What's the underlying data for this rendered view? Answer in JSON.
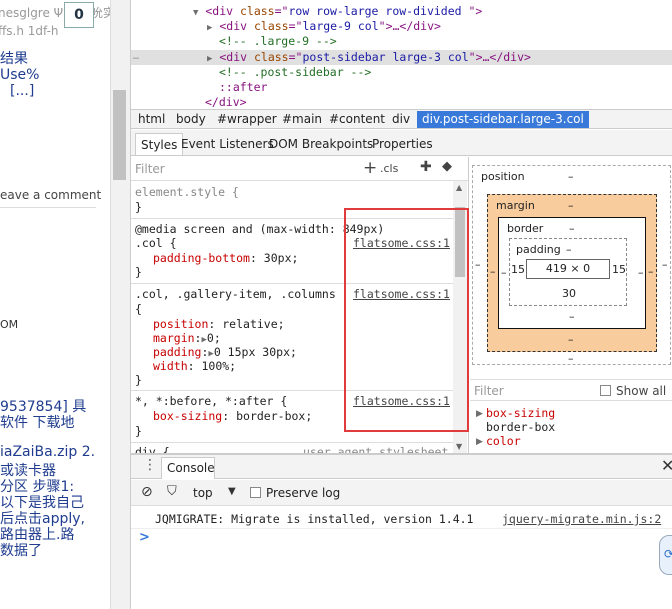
{
  "left_page": {
    "badge": "0",
    "line1": "nesglgre Ψ 要买吮实",
    "line2": "ffs.h 1df-h",
    "line3": "结果",
    "line4": "Use%",
    "line5": "[...]",
    "leave_comment": "eave a comment",
    "om": "OM",
    "line6": "9537854] 具",
    "line7": "软件 下载地",
    "line8": "iaZaiBa.zip 2.",
    "line9": "或读卡器",
    "line10": "分区 步骤1:",
    "line11": "以下是我自己",
    "line12": "后点击apply,",
    "line13": "路由器上.路",
    "line14": "数据了"
  },
  "dom_tree": {
    "line1": {
      "open": "<div ",
      "attr": "class",
      "eq": "=\"",
      "val": "row row-large row-divided ",
      "close": "\">"
    },
    "line2": {
      "open": "<div ",
      "attr": "class",
      "eq": "=\"",
      "val": "large-9 col",
      "close": "\">…</div>"
    },
    "line3": "<!-- .large-9 -->",
    "line4": {
      "open": "<div ",
      "attr": "class",
      "eq": "=\"",
      "val": "post-sidebar large-3 col",
      "close": "\">…</div>"
    },
    "line5": "<!-- .post-sidebar -->",
    "line6": "::after",
    "line7": "</div>",
    "dots": "…"
  },
  "breadcrumbs": [
    "html",
    "body",
    "#wrapper",
    "#main",
    "#content",
    "div",
    "div.post-sidebar.large-3.col"
  ],
  "subtabs": [
    "Styles",
    "Event Listeners",
    "DOM Breakpoints",
    "Properties"
  ],
  "styles": {
    "filter_placeholder": "Filter",
    "cls_label": ".cls",
    "element_style": "element.style {",
    "close_brace": "}",
    "media": "@media screen and (max-width: 849px)",
    "col_selector": ".col {",
    "pb_prop": "padding-bottom",
    "pb_val": "30px;",
    "src1": "flatsome.css:1",
    "sel2": ".col, .gallery-item, .columns",
    "open_brace": "{",
    "position_prop": "position",
    "position_val": "relative;",
    "margin_prop": "margin",
    "margin_val": "0;",
    "padding_prop": "padding",
    "padding_val": "0 15px 30px;",
    "width_prop": "width",
    "width_val": "100%;",
    "sel3": "*, *:before, *:after {",
    "bs_prop": "box-sizing",
    "bs_val": "border-box;",
    "sel4": "div {",
    "ua": "user agent stylesheet"
  },
  "box_model": {
    "position_label": "position",
    "dash": "–",
    "margin_label": "margin",
    "border_label": "border",
    "padding_label": "padding",
    "content": "419 × 0",
    "pad_left": "15",
    "pad_right": "15",
    "pad_bottom": "30"
  },
  "computed": {
    "filter_placeholder": "Filter",
    "show_all": "Show all",
    "prop1": "box-sizing",
    "val1": "border-box",
    "prop2": "color"
  },
  "console": {
    "tab": "Console",
    "context": "top",
    "preserve_log": "Preserve log",
    "message": "JQMIGRATE: Migrate is installed, version 1.4.1",
    "source": "jquery-migrate.min.js:2",
    "prompt": ">"
  },
  "colors": {
    "accent": "#3879d9",
    "highlight_box": "#e23b3b",
    "margin_fill": "#f9cc9d"
  }
}
